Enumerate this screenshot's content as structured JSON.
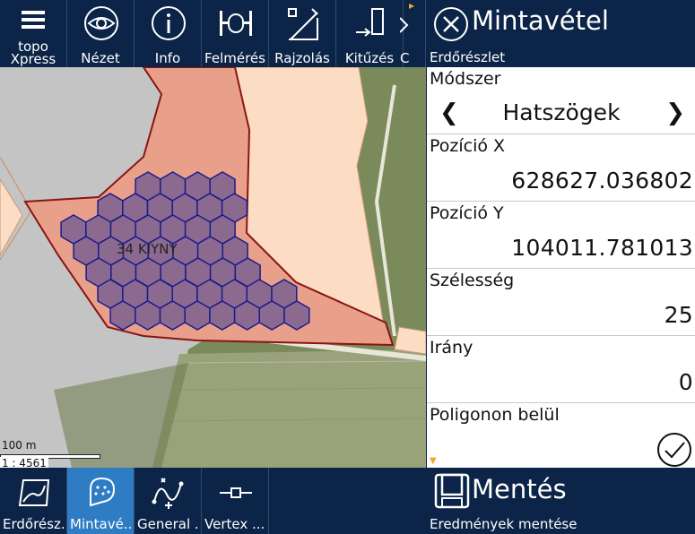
{
  "toolbar": {
    "logo_line1": "topo",
    "logo_line2": "Xpress",
    "items": [
      {
        "label": "Nézet",
        "icon": "eye-icon"
      },
      {
        "label": "Info",
        "icon": "info-icon"
      },
      {
        "label": "Felmérés",
        "icon": "survey-icon"
      },
      {
        "label": "Rajzolás",
        "icon": "drawing-icon"
      },
      {
        "label": "Kitűzés",
        "icon": "stakeout-icon"
      },
      {
        "label": "C",
        "icon": "partial-icon"
      }
    ]
  },
  "map": {
    "parcel_label": "34 KIYNY",
    "scale_distance": "100 m",
    "scale_ratio": "1 : 4561",
    "colors": {
      "parcel_fill": "#e9a08a",
      "neighbor_fill": "#fcdcc2",
      "hexagon_fill": "#8c6a8f",
      "hexagon_stroke": "#1a1a8c",
      "border": "#8a1414"
    }
  },
  "bottom_tabs": [
    {
      "label": "Erdőrész...",
      "icon": "forest-parcel-icon",
      "active": false
    },
    {
      "label": "Mintavé...",
      "icon": "sampling-icon",
      "active": true
    },
    {
      "label": "General ...",
      "icon": "generalize-icon",
      "active": false
    },
    {
      "label": "Vertex ...",
      "icon": "vertex-icon",
      "active": false
    }
  ],
  "panel": {
    "title": "Mintavétel",
    "subtitle": "Erdőrészlet",
    "method": {
      "label": "Módszer",
      "value": "Hatszögek"
    },
    "pos_x": {
      "label": "Pozíció X",
      "value": "628627.036802"
    },
    "pos_y": {
      "label": "Pozíció Y",
      "value": "104011.781013"
    },
    "width": {
      "label": "Szélesség",
      "value": "25"
    },
    "direction": {
      "label": "Irány",
      "value": "0"
    },
    "inside_polygon": {
      "label": "Poligonon belül",
      "checked": true
    }
  },
  "save": {
    "title": "Mentés",
    "subtitle": "Eredmények mentése"
  }
}
